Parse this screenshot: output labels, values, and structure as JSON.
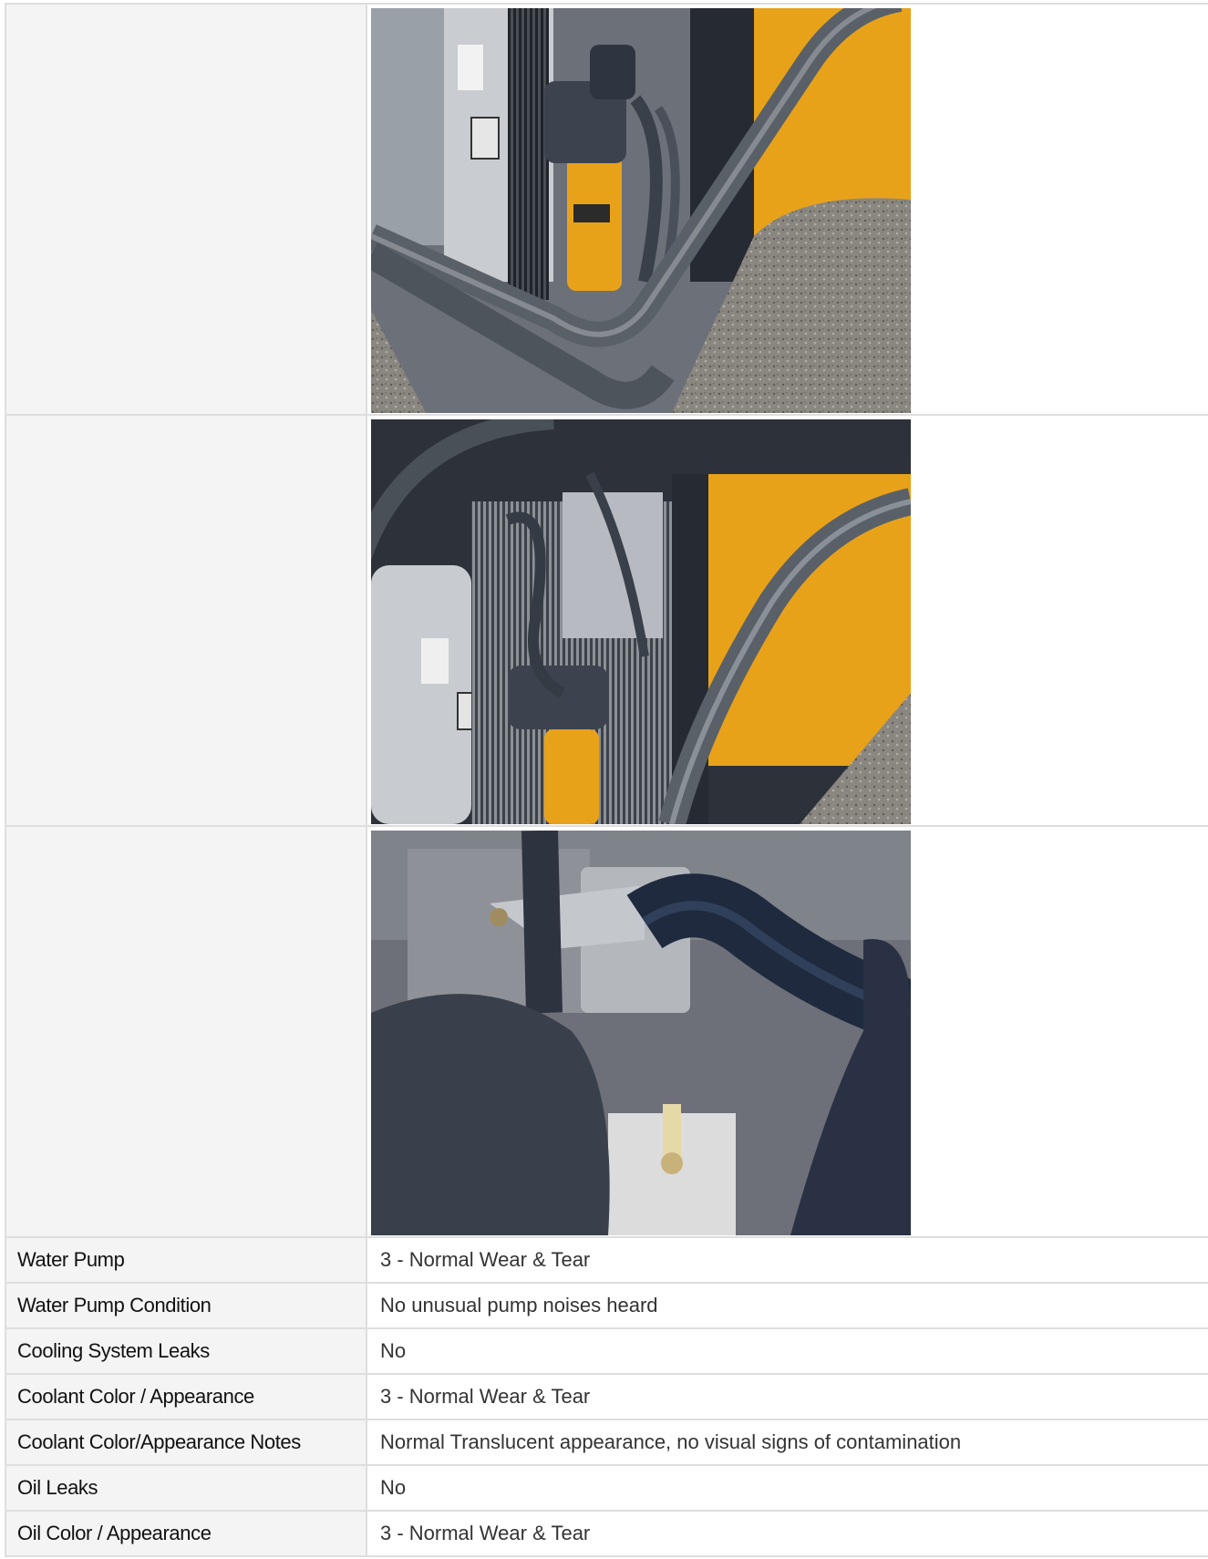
{
  "rows": [
    {
      "label": "Water Pump",
      "value": "3 - Normal Wear & Tear"
    },
    {
      "label": "Water Pump Condition",
      "value": "No unusual pump noises heard"
    },
    {
      "label": "Cooling System Leaks",
      "value": "No"
    },
    {
      "label": "Coolant Color / Appearance",
      "value": "3 - Normal Wear & Tear"
    },
    {
      "label": "Coolant Color/Appearance Notes",
      "value": "Normal Translucent appearance, no visual signs of contamination"
    },
    {
      "label": "Oil Leaks",
      "value": "No"
    },
    {
      "label": "Oil Color / Appearance",
      "value": "3 - Normal Wear & Tear"
    }
  ],
  "colors": {
    "label_bg": "#f4f4f4",
    "border": "#dedede",
    "machine_yellow": "#e8a21a",
    "metal_gray": "#9a9ea3",
    "hose_dark": "#2c3340"
  }
}
